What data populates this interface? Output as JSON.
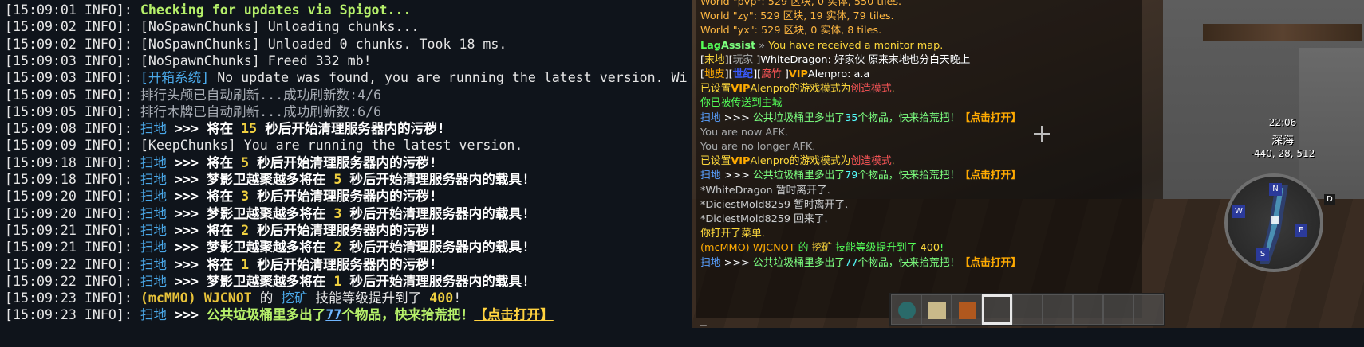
{
  "terminal": {
    "lines": [
      {
        "ts": "[15:09:01 INFO]: ",
        "segs": [
          {
            "t": "Checking for updates via Spigot...",
            "s": "s-green"
          }
        ]
      },
      {
        "ts": "[15:09:02 INFO]: ",
        "segs": [
          {
            "t": "[NoSpawnChunks] Unloading chunks...",
            "s": ""
          }
        ]
      },
      {
        "ts": "[15:09:02 INFO]: ",
        "segs": [
          {
            "t": "[NoSpawnChunks] Unloaded 0 chunks. Took 18 ms.",
            "s": ""
          }
        ]
      },
      {
        "ts": "[15:09:03 INFO]: ",
        "segs": [
          {
            "t": "[NoSpawnChunks] Freed 332 mb!",
            "s": ""
          }
        ]
      },
      {
        "ts": "[15:09:03 INFO]: ",
        "segs": [
          {
            "t": "[开箱系统]",
            "s": "s-blue s-bold"
          },
          {
            "t": " No update was found, you are running the latest version. Wi",
            "s": ""
          }
        ]
      },
      {
        "ts": "[15:09:05 INFO]: ",
        "segs": [
          {
            "t": "排行头颅已自动刷新...成功刷新数:4/6",
            "s": "s-gray"
          }
        ]
      },
      {
        "ts": "[15:09:05 INFO]: ",
        "segs": [
          {
            "t": "排行木牌已自动刷新...成功刷新数:6/6",
            "s": "s-gray"
          }
        ]
      },
      {
        "ts": "[15:09:08 INFO]: ",
        "segs": [
          {
            "t": "扫地",
            "s": "s-blue"
          },
          {
            "t": " >>> 将在 ",
            "s": "s-bwhite"
          },
          {
            "t": "15",
            "s": "s-num"
          },
          {
            "t": " 秒后开始清理服务器内的污秽!",
            "s": "s-bwhite"
          }
        ]
      },
      {
        "ts": "[15:09:09 INFO]: ",
        "segs": [
          {
            "t": "[KeepChunks] You are running the latest version.",
            "s": ""
          }
        ]
      },
      {
        "ts": "[15:09:18 INFO]: ",
        "segs": [
          {
            "t": "扫地",
            "s": "s-blue"
          },
          {
            "t": " >>> 将在 ",
            "s": "s-bwhite"
          },
          {
            "t": "5",
            "s": "s-num"
          },
          {
            "t": " 秒后开始清理服务器内的污秽!",
            "s": "s-bwhite"
          }
        ]
      },
      {
        "ts": "[15:09:18 INFO]: ",
        "segs": [
          {
            "t": "扫地",
            "s": "s-blue"
          },
          {
            "t": " >>> 梦影卫越聚越多将在 ",
            "s": "s-bwhite"
          },
          {
            "t": "5",
            "s": "s-num"
          },
          {
            "t": " 秒后开始清理服务器内的载具!",
            "s": "s-bwhite"
          }
        ]
      },
      {
        "ts": "[15:09:20 INFO]: ",
        "segs": [
          {
            "t": "扫地",
            "s": "s-blue"
          },
          {
            "t": " >>> 将在 ",
            "s": "s-bwhite"
          },
          {
            "t": "3",
            "s": "s-num"
          },
          {
            "t": " 秒后开始清理服务器内的污秽!",
            "s": "s-bwhite"
          }
        ]
      },
      {
        "ts": "[15:09:20 INFO]: ",
        "segs": [
          {
            "t": "扫地",
            "s": "s-blue"
          },
          {
            "t": " >>> 梦影卫越聚越多将在 ",
            "s": "s-bwhite"
          },
          {
            "t": "3",
            "s": "s-num"
          },
          {
            "t": " 秒后开始清理服务器内的载具!",
            "s": "s-bwhite"
          }
        ]
      },
      {
        "ts": "[15:09:21 INFO]: ",
        "segs": [
          {
            "t": "扫地",
            "s": "s-blue"
          },
          {
            "t": " >>> 将在 ",
            "s": "s-bwhite"
          },
          {
            "t": "2",
            "s": "s-num"
          },
          {
            "t": " 秒后开始清理服务器内的污秽!",
            "s": "s-bwhite"
          }
        ]
      },
      {
        "ts": "[15:09:21 INFO]: ",
        "segs": [
          {
            "t": "扫地",
            "s": "s-blue"
          },
          {
            "t": " >>> 梦影卫越聚越多将在 ",
            "s": "s-bwhite"
          },
          {
            "t": "2",
            "s": "s-num"
          },
          {
            "t": " 秒后开始清理服务器内的载具!",
            "s": "s-bwhite"
          }
        ]
      },
      {
        "ts": "[15:09:22 INFO]: ",
        "segs": [
          {
            "t": "扫地",
            "s": "s-blue"
          },
          {
            "t": " >>> 将在 ",
            "s": "s-bwhite"
          },
          {
            "t": "1",
            "s": "s-num"
          },
          {
            "t": " 秒后开始清理服务器内的污秽!",
            "s": "s-bwhite"
          }
        ]
      },
      {
        "ts": "[15:09:22 INFO]: ",
        "segs": [
          {
            "t": "扫地",
            "s": "s-blue"
          },
          {
            "t": " >>> 梦影卫越聚越多将在 ",
            "s": "s-bwhite"
          },
          {
            "t": "1",
            "s": "s-num"
          },
          {
            "t": " 秒后开始清理服务器内的载具!",
            "s": "s-bwhite"
          }
        ]
      },
      {
        "ts": "[15:09:23 INFO]: ",
        "segs": [
          {
            "t": "(mcMMO)",
            "s": "s-gold"
          },
          {
            "t": " WJCNOT",
            "s": "s-gold"
          },
          {
            "t": " 的 ",
            "s": ""
          },
          {
            "t": "挖矿",
            "s": "s-blue"
          },
          {
            "t": " 技能等级提升到了 ",
            "s": ""
          },
          {
            "t": "400",
            "s": "s-num"
          },
          {
            "t": "!",
            "s": ""
          }
        ]
      },
      {
        "ts": "[15:09:23 INFO]: ",
        "segs": [
          {
            "t": "扫地",
            "s": "s-blue"
          },
          {
            "t": " >>> ",
            "s": "s-bwhite"
          },
          {
            "t": "公共垃圾桶里多出了",
            "s": "s-green"
          },
          {
            "t": "77",
            "s": "s-link"
          },
          {
            "t": "个物品，快来拾荒把！",
            "s": "s-green"
          },
          {
            "t": "【点击打开】",
            "s": "s-click"
          }
        ]
      }
    ]
  },
  "game": {
    "chat": [
      {
        "segs": [
          {
            "t": "World \"pvp\": 529 区块, 0 实体, 550 tiles.",
            "c": "c-orange"
          }
        ]
      },
      {
        "segs": [
          {
            "t": "World \"zy\": 529 区块, 19 实体, 79 tiles.",
            "c": "c-orange"
          }
        ]
      },
      {
        "segs": [
          {
            "t": "World \"yx\": 529 区块, 0 实体, 8 tiles.",
            "c": "c-orange"
          }
        ]
      },
      {
        "segs": [
          {
            "t": "Lag",
            "c": "c-green c-bold"
          },
          {
            "t": "Assist",
            "c": "c-lgreen c-bold"
          },
          {
            "t": " » ",
            "c": "c-gray"
          },
          {
            "t": "You have received a monitor map.",
            "c": "c-yellow"
          }
        ]
      },
      {
        "segs": [
          {
            "t": "[",
            "c": "c-white"
          },
          {
            "t": "末地",
            "c": "c-yellow"
          },
          {
            "t": "][",
            "c": "c-white"
          },
          {
            "t": "玩家",
            "c": "c-gray"
          },
          {
            "t": " ]WhiteDragon: ",
            "c": "c-white"
          },
          {
            "t": "好家伙 原来末地也分白天晚上",
            "c": "c-white"
          }
        ]
      },
      {
        "segs": [
          {
            "t": "[",
            "c": "c-white"
          },
          {
            "t": "地皮",
            "c": "c-gold"
          },
          {
            "t": "][",
            "c": "c-white"
          },
          {
            "t": "世纪",
            "c": "c-dblue c-bold"
          },
          {
            "t": "][",
            "c": "c-white"
          },
          {
            "t": "腐竹",
            "c": "c-red"
          },
          {
            "t": " ]",
            "c": "c-white"
          },
          {
            "t": "VIP",
            "c": "c-gold c-bold"
          },
          {
            "t": "Alenpro: a.a",
            "c": "c-white"
          }
        ]
      },
      {
        "segs": [
          {
            "t": "已设置",
            "c": "c-yellow"
          },
          {
            "t": "VIP",
            "c": "c-gold c-bold"
          },
          {
            "t": "Alenpro",
            "c": "c-yellow"
          },
          {
            "t": "的游戏模式为",
            "c": "c-yellow"
          },
          {
            "t": "创造模式",
            "c": "c-red"
          },
          {
            "t": ".",
            "c": "c-yellow"
          }
        ]
      },
      {
        "segs": [
          {
            "t": "你已被传送到主城",
            "c": "c-green"
          }
        ]
      },
      {
        "segs": [
          {
            "t": "扫地",
            "c": "c-blue"
          },
          {
            "t": " >>> ",
            "c": "c-white"
          },
          {
            "t": "公共垃圾桶里多出了",
            "c": "c-lgreen"
          },
          {
            "t": "35",
            "c": "c-aqua"
          },
          {
            "t": "个物品，快来拾荒把！",
            "c": "c-lgreen"
          },
          {
            "t": "【点击打开】",
            "c": "c-gold c-bold"
          }
        ]
      },
      {
        "segs": [
          {
            "t": "You are now AFK.",
            "c": "c-gray"
          }
        ]
      },
      {
        "segs": [
          {
            "t": "You are no longer AFK.",
            "c": "c-gray"
          }
        ]
      },
      {
        "segs": [
          {
            "t": "已设置",
            "c": "c-yellow"
          },
          {
            "t": "VIP",
            "c": "c-gold c-bold"
          },
          {
            "t": "Alenpro",
            "c": "c-yellow"
          },
          {
            "t": "的游戏模式为",
            "c": "c-yellow"
          },
          {
            "t": "创造模式",
            "c": "c-red"
          },
          {
            "t": ".",
            "c": "c-yellow"
          }
        ]
      },
      {
        "segs": [
          {
            "t": "扫地",
            "c": "c-blue"
          },
          {
            "t": " >>> ",
            "c": "c-white"
          },
          {
            "t": "公共垃圾桶里多出了",
            "c": "c-lgreen"
          },
          {
            "t": "79",
            "c": "c-aqua"
          },
          {
            "t": "个物品，快来拾荒把！",
            "c": "c-lgreen"
          },
          {
            "t": "【点击打开】",
            "c": "c-gold c-bold"
          }
        ]
      },
      {
        "segs": [
          {
            "t": "*WhiteDragon 暂时离开了.",
            "c": "c-lgray"
          }
        ]
      },
      {
        "segs": [
          {
            "t": "*DiciestMold8259 暂时离开了.",
            "c": "c-lgray"
          }
        ]
      },
      {
        "segs": [
          {
            "t": "*DiciestMold8259 回来了.",
            "c": "c-lgray"
          }
        ]
      },
      {
        "segs": [
          {
            "t": "你打开了菜单.",
            "c": "c-yellow"
          }
        ]
      },
      {
        "segs": [
          {
            "t": "(mcMMO) WJCNOT",
            "c": "c-gold"
          },
          {
            "t": " 的 ",
            "c": "c-green"
          },
          {
            "t": "挖矿",
            "c": "c-yellow"
          },
          {
            "t": " 技能等级提升到了 ",
            "c": "c-green"
          },
          {
            "t": "400",
            "c": "c-yellow"
          },
          {
            "t": "!",
            "c": "c-green"
          }
        ]
      },
      {
        "segs": [
          {
            "t": "扫地",
            "c": "c-blue"
          },
          {
            "t": " >>> ",
            "c": "c-white"
          },
          {
            "t": "公共垃圾桶里多出了",
            "c": "c-lgreen"
          },
          {
            "t": "77",
            "c": "c-aqua"
          },
          {
            "t": "个物品，快来拾荒把！",
            "c": "c-lgreen"
          },
          {
            "t": "【点击打开】",
            "c": "c-gold c-bold"
          }
        ]
      }
    ],
    "chat_cursor": "_",
    "hud": {
      "time": "22:06",
      "biome": "深海",
      "coords": "-440, 28, 512"
    },
    "minimap_dirs": {
      "n": "N",
      "w": "W",
      "e": "E",
      "s": "S",
      "d": "D"
    },
    "hotbar": {
      "slots": [
        {
          "item": "ender-pearl-icon",
          "color": "#2a6a6a"
        },
        {
          "item": "map-icon",
          "color": "#c9b98a"
        },
        {
          "item": "command-block-icon",
          "color": "#b0581e"
        },
        {
          "item": "",
          "color": "",
          "selected": true
        },
        {
          "item": "",
          "color": ""
        },
        {
          "item": "",
          "color": ""
        },
        {
          "item": "",
          "color": ""
        },
        {
          "item": "",
          "color": ""
        },
        {
          "item": "",
          "color": ""
        }
      ]
    }
  }
}
